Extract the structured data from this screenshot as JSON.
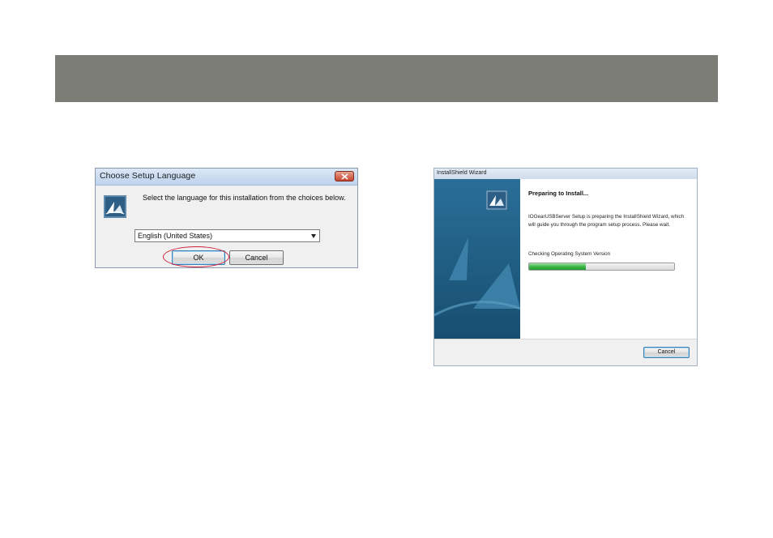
{
  "language_dialog": {
    "title": "Choose Setup Language",
    "prompt": "Select the language for this installation from the choices below.",
    "language_select_value": "English (United States)",
    "ok_label": "OK",
    "cancel_label": "Cancel",
    "icons": [
      "app-setup-icon",
      "close-icon",
      "dropdown-arrow-icon"
    ]
  },
  "wizard_dialog": {
    "title": "InstallShield Wizard",
    "heading": "Preparing to Install...",
    "description": "IOGearUSBServer Setup is preparing the InstallShield Wizard, which will guide you through the program setup process.  Please wait.",
    "status": "Checking Operating System Version",
    "progress_fraction": 0.39,
    "cancel_label": "Cancel",
    "icons": [
      "installshield-icon"
    ]
  },
  "colors": {
    "header_band": "#7d7d77",
    "highlight": "#d0213a",
    "progress_fill": "#3fb54a",
    "side_panel": "#1f5f86"
  }
}
